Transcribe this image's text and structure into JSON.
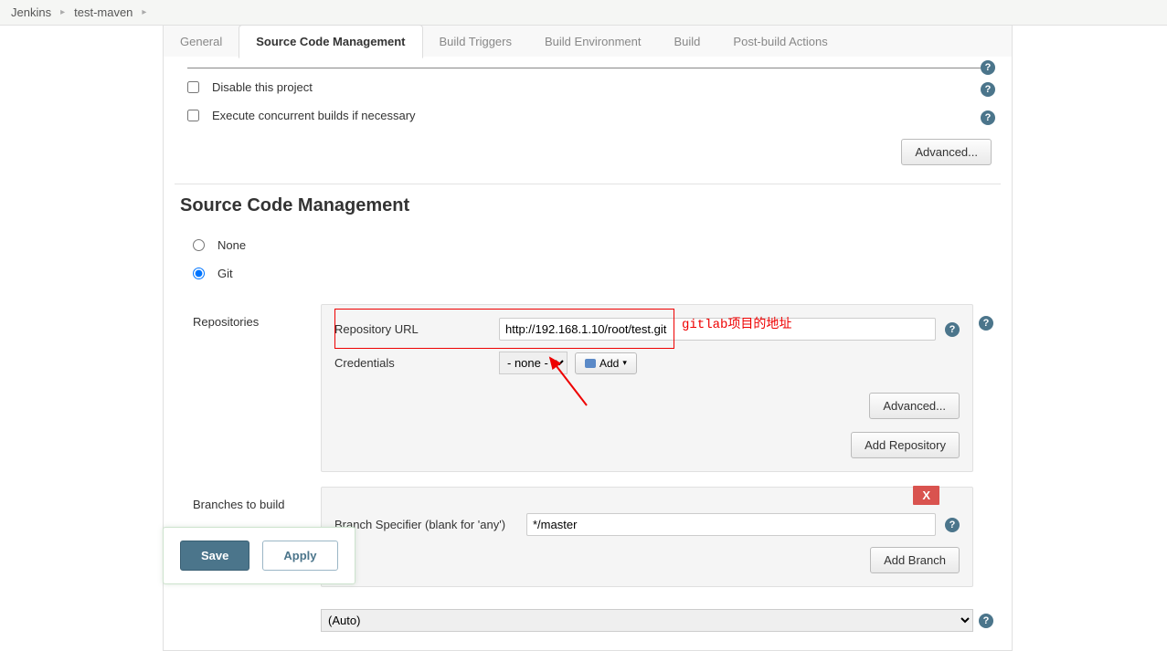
{
  "breadcrumb": {
    "root": "Jenkins",
    "project": "test-maven"
  },
  "tabs": {
    "general": "General",
    "scm": "Source Code Management",
    "triggers": "Build Triggers",
    "env": "Build Environment",
    "build": "Build",
    "post": "Post-build Actions"
  },
  "options": {
    "disable_project": "Disable this project",
    "concurrent": "Execute concurrent builds if necessary",
    "advanced": "Advanced..."
  },
  "scm": {
    "title": "Source Code Management",
    "none": "None",
    "git": "Git",
    "repositories_label": "Repositories",
    "repo_url_label": "Repository URL",
    "repo_url_value": "http://192.168.1.10/root/test.git",
    "credentials_label": "Credentials",
    "credentials_value": "- none -",
    "add_label": "Add",
    "advanced": "Advanced...",
    "add_repository": "Add Repository",
    "branches_label": "Branches to build",
    "branch_spec_label": "Branch Specifier (blank for 'any')",
    "branch_spec_value": "*/master",
    "add_branch": "Add Branch",
    "delete_x": "X",
    "auto_option": "(Auto)"
  },
  "annotation": {
    "gitlab_addr": "gitlab项目的地址"
  },
  "buttons": {
    "save": "Save",
    "apply": "Apply"
  }
}
